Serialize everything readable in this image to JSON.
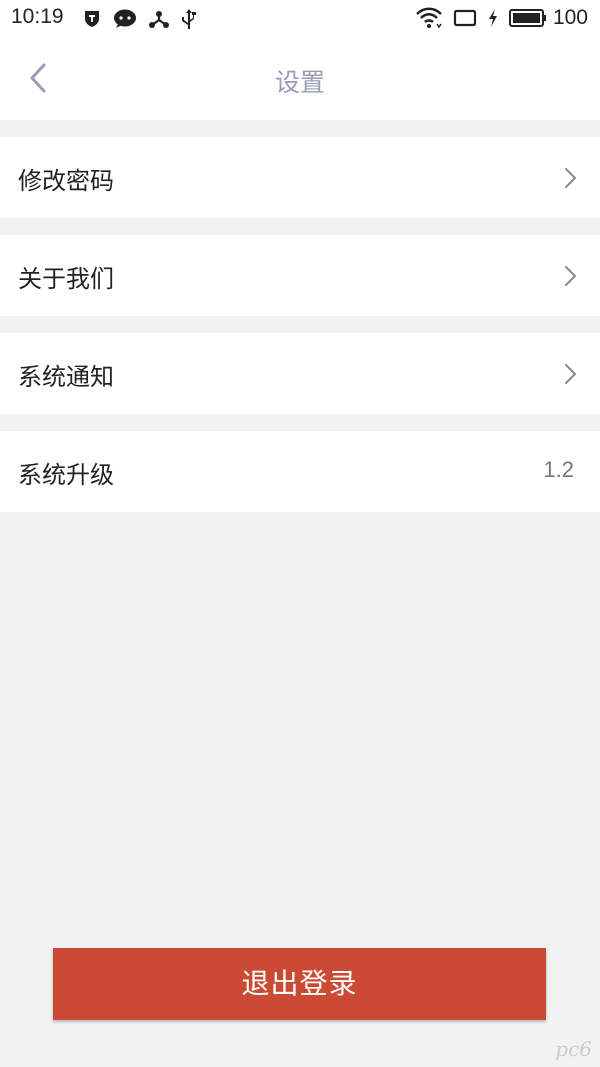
{
  "statusbar": {
    "time": "10:19",
    "battery_level": "100",
    "left_icons": [
      "shield-icon",
      "chat-bubble-icon",
      "share-nodes-icon",
      "usb-icon"
    ],
    "right_icons": [
      "wifi-icon",
      "tablet-icon",
      "charging-bolt-icon",
      "battery-icon"
    ]
  },
  "header": {
    "title": "设置",
    "back_icon": "chevron-left-icon",
    "accent_color": "#9a9bb5"
  },
  "settings": {
    "items": [
      {
        "label": "修改密码",
        "trailing": "chevron-right-icon"
      },
      {
        "label": "关于我们",
        "trailing": "chevron-right-icon"
      },
      {
        "label": "系统通知",
        "trailing": "chevron-right-icon"
      },
      {
        "label": "系统升级",
        "value": "1.2"
      }
    ]
  },
  "logout": {
    "label": "退出登录",
    "color": "#cb4a33"
  },
  "watermark": {
    "text": "pc6"
  }
}
